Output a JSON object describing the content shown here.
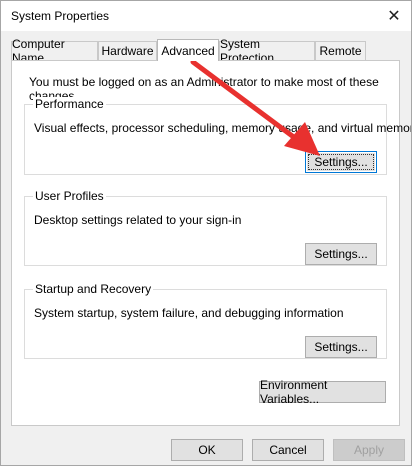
{
  "window": {
    "title": "System Properties"
  },
  "tabs": [
    {
      "label": "Computer Name"
    },
    {
      "label": "Hardware"
    },
    {
      "label": "Advanced"
    },
    {
      "label": "System Protection"
    },
    {
      "label": "Remote"
    }
  ],
  "note": "You must be logged on as an Administrator to make most of these changes.",
  "groups": {
    "performance": {
      "title": "Performance",
      "desc": "Visual effects, processor scheduling, memory usage, and virtual memory",
      "button": "Settings..."
    },
    "profiles": {
      "title": "User Profiles",
      "desc": "Desktop settings related to your sign-in",
      "button": "Settings..."
    },
    "startup": {
      "title": "Startup and Recovery",
      "desc": "System startup, system failure, and debugging information",
      "button": "Settings..."
    }
  },
  "env_button": "Environment Variables...",
  "footer": {
    "ok": "OK",
    "cancel": "Cancel",
    "apply": "Apply"
  },
  "icons": {
    "close": "close-icon",
    "arrow": "red-arrow-annotation"
  },
  "colors": {
    "arrow": "#e8312f",
    "focus": "#0078d7"
  }
}
